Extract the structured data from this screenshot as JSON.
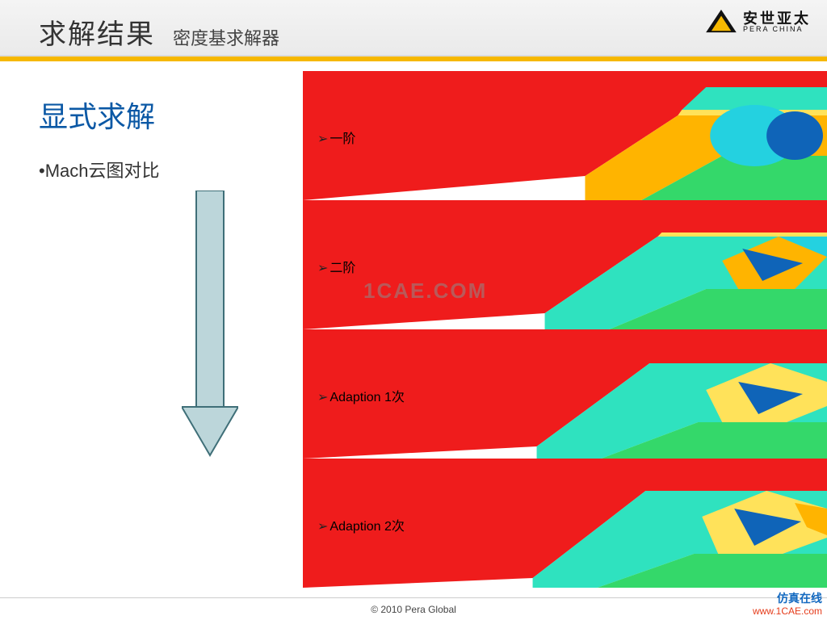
{
  "header": {
    "title": "求解结果",
    "subtitle": "密度基求解器",
    "brand_zh": "安世亚太",
    "brand_en": "PERA CHINA"
  },
  "content": {
    "heading": "显式求解",
    "bullet": "•Mach云图对比"
  },
  "rows": [
    {
      "label": "一阶"
    },
    {
      "label": "二阶"
    },
    {
      "label": "Adaption 1次"
    },
    {
      "label": "Adaption 2次"
    }
  ],
  "watermark": "1CAE.COM",
  "footer": "© 2010 Pera Global",
  "corner": {
    "line1": "仿真在线",
    "line2": "www.1CAE.com"
  }
}
